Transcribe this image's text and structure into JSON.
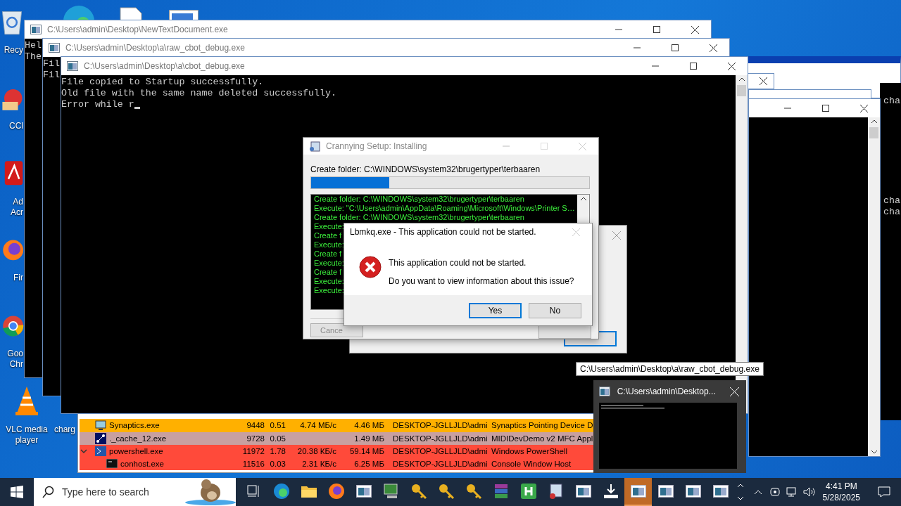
{
  "desktop_icons": [
    {
      "kind": "recycle",
      "lines": [
        "Recy"
      ]
    },
    {
      "kind": "ccleaner",
      "lines": [
        "CCl"
      ]
    },
    {
      "kind": "acrobat",
      "lines": [
        "Ad",
        "Acr"
      ]
    },
    {
      "kind": "firefox",
      "lines": [
        "Fir"
      ]
    },
    {
      "kind": "chrome",
      "lines": [
        "Goo",
        "Chr"
      ]
    },
    {
      "kind": "vlc",
      "lines": [
        "VLC media",
        "player"
      ]
    }
  ],
  "desktop_label_2": "charg",
  "consoles": [
    {
      "title": "C:\\Users\\admin\\Desktop\\NewTextDocument.exe",
      "lines": [
        "Hel",
        "The"
      ],
      "cursor": false
    },
    {
      "title": "C:\\Users\\admin\\Desktop\\a\\raw_cbot_debug.exe",
      "lines": [
        "Fil",
        "Fil"
      ],
      "cursor": false
    },
    {
      "title": "C:\\Users\\admin\\Desktop\\a\\cbot_debug.exe",
      "lines": [
        "File copied to Startup successfully.",
        "Old file with the same name deleted successfully.",
        "Error while r"
      ],
      "cursor": true
    }
  ],
  "right_console": {
    "blocks": [
      [
        "cha"
      ],
      [
        "cha",
        "cha"
      ]
    ]
  },
  "process_table": {
    "rows": [
      {
        "name": "Synaptics.exe",
        "kind": "monitor",
        "pid": "9448",
        "cpu": "0.51",
        "io": "4.74 МБ/с",
        "memory": "4.46 МБ",
        "user": "DESKTOP-JGLLJLD\\admi",
        "description": "Synaptics Pointing Device D",
        "color": "#ffb000"
      },
      {
        "name": "._cache_12.exe",
        "kind": "network",
        "pid": "9728",
        "cpu": "0.05",
        "memory": "1.49 МБ",
        "user": "DESKTOP-JGLLJLD\\admi",
        "description": "MIDIDevDemo v2 MFC Appl",
        "color": "#c8a0a0"
      },
      {
        "name": "powershell.exe",
        "kind": "shell",
        "pid": "11972",
        "cpu": "1.78",
        "io": "20.38 КБ/с",
        "memory": "59.14 МБ",
        "user": "DESKTOP-JGLLJLD\\admi",
        "description": "Windows PowerShell",
        "color": "#ff4a3a",
        "expanded": true,
        "children": [
          {
            "name": "conhost.exe",
            "kind": "console",
            "pid": "11516",
            "cpu": "0.03",
            "io": "2.31 КБ/с",
            "memory": "6.25 МБ",
            "user": "DESKTOP-JGLLJLD\\admi",
            "description": "Console Window Host",
            "color": "#ff4a3a"
          }
        ]
      }
    ]
  },
  "setup": {
    "title": "Crannying Setup: Installing",
    "status": "Create folder: C:\\WINDOWS\\system32\\brugertyper\\terbaaren",
    "level": 0.28,
    "log": [
      "Create folder: C:\\WINDOWS\\system32\\brugertyper\\terbaaren",
      "Execute: \"C:\\Users\\admin\\AppData\\Roaming\\Microsoft\\Windows\\Printer S…",
      "Create folder: C:\\WINDOWS\\system32\\brugertyper\\terbaaren",
      "Execute:",
      "Create f",
      "Execute:",
      "Create f",
      "Execute:",
      "Create f",
      "Execute:",
      "Execute:"
    ],
    "cancel_button": "Cance"
  },
  "error_dialog": {
    "title": "Lbmkq.exe - This application could not be started.",
    "message": "This application could not be started.",
    "question": "Do you want to view information about this issue?",
    "buttons": [
      {
        "label": "Yes",
        "selected": true
      },
      {
        "label": "No",
        "selected": false
      }
    ]
  },
  "tooltip": "C:\\Users\\admin\\Desktop\\a\\raw_cbot_debug.exe",
  "thumbnail": {
    "title": "C:\\Users\\admin\\Desktop..."
  },
  "taskbar": {
    "search_placeholder": "Type here to search",
    "apps": [
      {
        "kind": "taskview",
        "active": false
      },
      {
        "kind": "edge",
        "active": false
      },
      {
        "kind": "explorer",
        "active": false
      },
      {
        "kind": "firefox",
        "active": false
      },
      {
        "kind": "console",
        "active": false
      },
      {
        "kind": "computer",
        "active": false
      },
      {
        "kind": "key",
        "active": false
      },
      {
        "kind": "key",
        "active": false
      },
      {
        "kind": "key",
        "active": false
      },
      {
        "kind": "archive",
        "active": false
      },
      {
        "kind": "happ",
        "active": false
      },
      {
        "kind": "installer",
        "active": false
      },
      {
        "kind": "console",
        "active": false
      },
      {
        "kind": "download",
        "active": false
      },
      {
        "kind": "console",
        "active": true
      },
      {
        "kind": "console",
        "active": false
      },
      {
        "kind": "console",
        "active": false
      },
      {
        "kind": "console",
        "active": false
      }
    ],
    "time": "4:41 PM",
    "date": "5/28/2025"
  }
}
